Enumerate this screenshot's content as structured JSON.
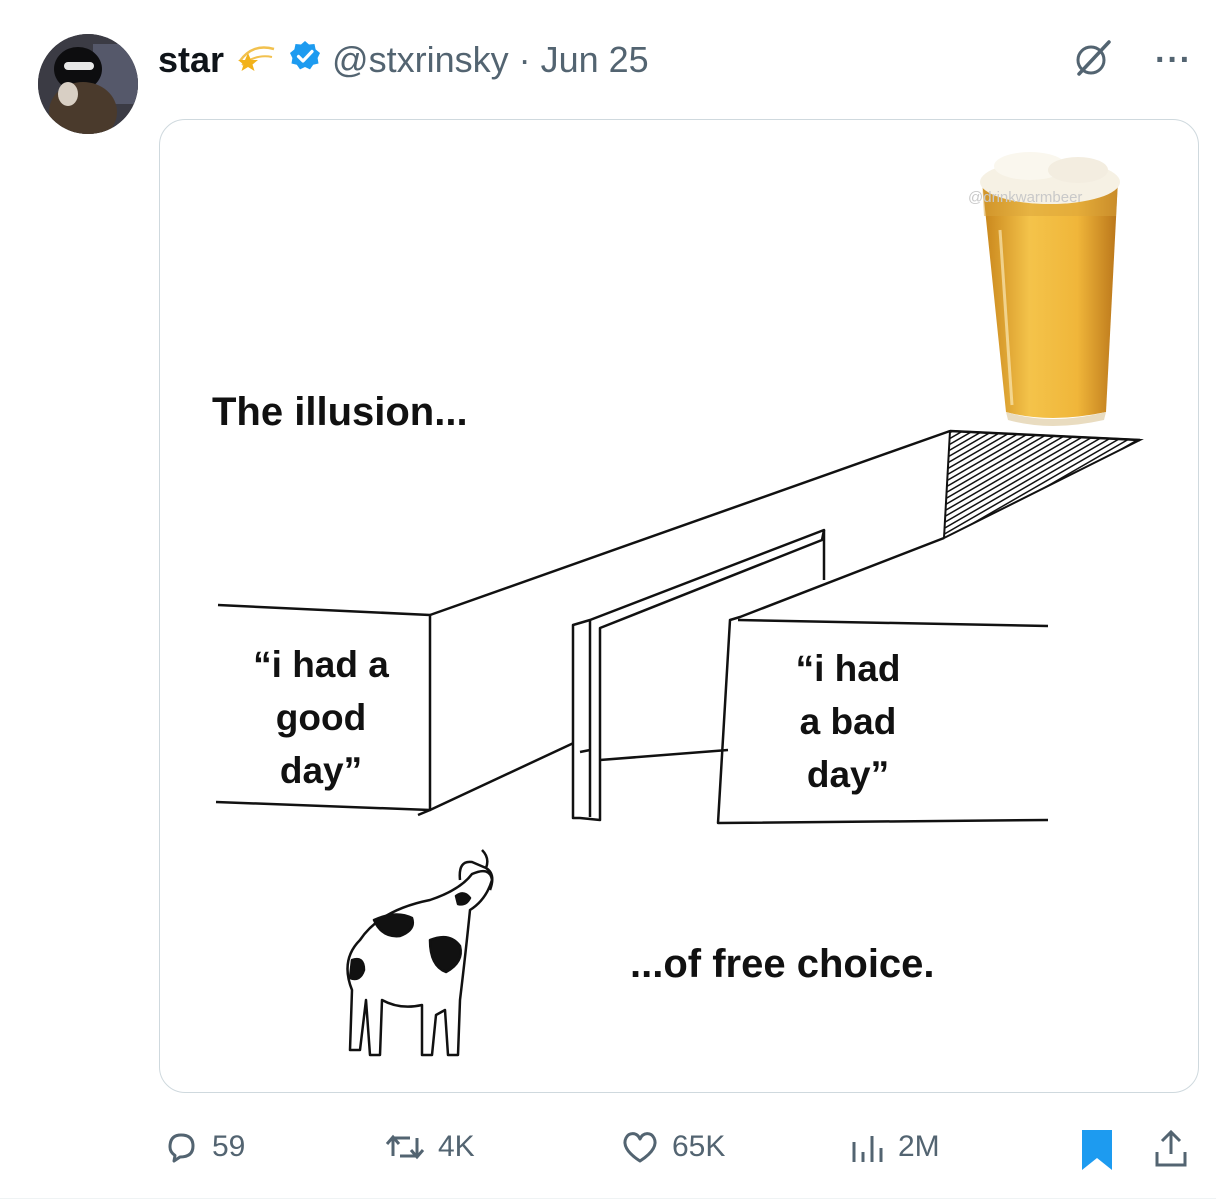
{
  "user": {
    "display_name": "star",
    "handle": "@stxrinsky",
    "date": "Jun 25",
    "separator": "·",
    "badge_icon": "shooting-star-icon",
    "verified_icon": "verified-badge-icon",
    "verified_color": "#1d9bf0"
  },
  "header_actions": {
    "grok_icon": "grok-icon",
    "more_label": "···"
  },
  "meme": {
    "watermark": "@drinkwarmbeer",
    "title": "The illusion...",
    "left_label_line1": "“i had a",
    "left_label_line2": "good",
    "left_label_line3": "day”",
    "right_label_line1": "“i had",
    "right_label_line2": "a bad",
    "right_label_line3": "day”",
    "caption": "...of free choice."
  },
  "metrics": {
    "replies": "59",
    "reposts": "4K",
    "likes": "65K",
    "views": "2M"
  },
  "colors": {
    "muted": "#536471",
    "bookmark_active": "#1d9bf0",
    "beer": "#e8a82a"
  }
}
